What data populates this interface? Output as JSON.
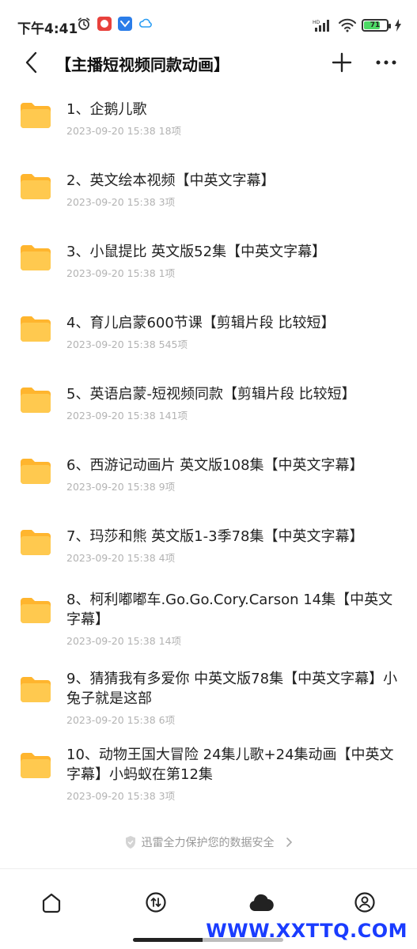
{
  "status_bar": {
    "time": "下午4:41",
    "battery_level": "71",
    "battery_fraction": 0.71
  },
  "header": {
    "title": "【主播短视频同款动画】"
  },
  "items": [
    {
      "name": "1、企鹅儿歌",
      "meta": "2023-09-20 15:38 18项"
    },
    {
      "name": "2、英文绘本视频【中英文字幕】",
      "meta": "2023-09-20 15:38 3项"
    },
    {
      "name": "3、小鼠提比 英文版52集【中英文字幕】",
      "meta": "2023-09-20 15:38 1项"
    },
    {
      "name": "4、育儿启蒙600节课【剪辑片段 比较短】",
      "meta": "2023-09-20 15:38 545项"
    },
    {
      "name": "5、英语启蒙-短视频同款【剪辑片段 比较短】",
      "meta": "2023-09-20 15:38 141项"
    },
    {
      "name": "6、西游记动画片 英文版108集【中英文字幕】",
      "meta": "2023-09-20 15:38 9项"
    },
    {
      "name": "7、玛莎和熊 英文版1-3季78集【中英文字幕】",
      "meta": "2023-09-20 15:38 4项"
    },
    {
      "name": "8、柯利嘟嘟车.Go.Go.Cory.Carson 14集【中英文字幕】",
      "meta": "2023-09-20 15:38 14项"
    },
    {
      "name": "9、猜猜我有多爱你 中英文版78集【中英文字幕】小兔子就是这部",
      "meta": "2023-09-20 15:38 6项"
    },
    {
      "name": "10、动物王国大冒险 24集儿歌+24集动画【中英文字幕】小蚂蚁在第12集",
      "meta": "2023-09-20 15:38 3项"
    }
  ],
  "secure_note": "迅雷全力保护您的数据安全",
  "watermark": "WWW.XXTTQ.COM",
  "colors": {
    "folder": "#ffc24a",
    "folder_back": "#ffb52e",
    "watermark": "#1a3cff",
    "battery": "#4cd964"
  }
}
